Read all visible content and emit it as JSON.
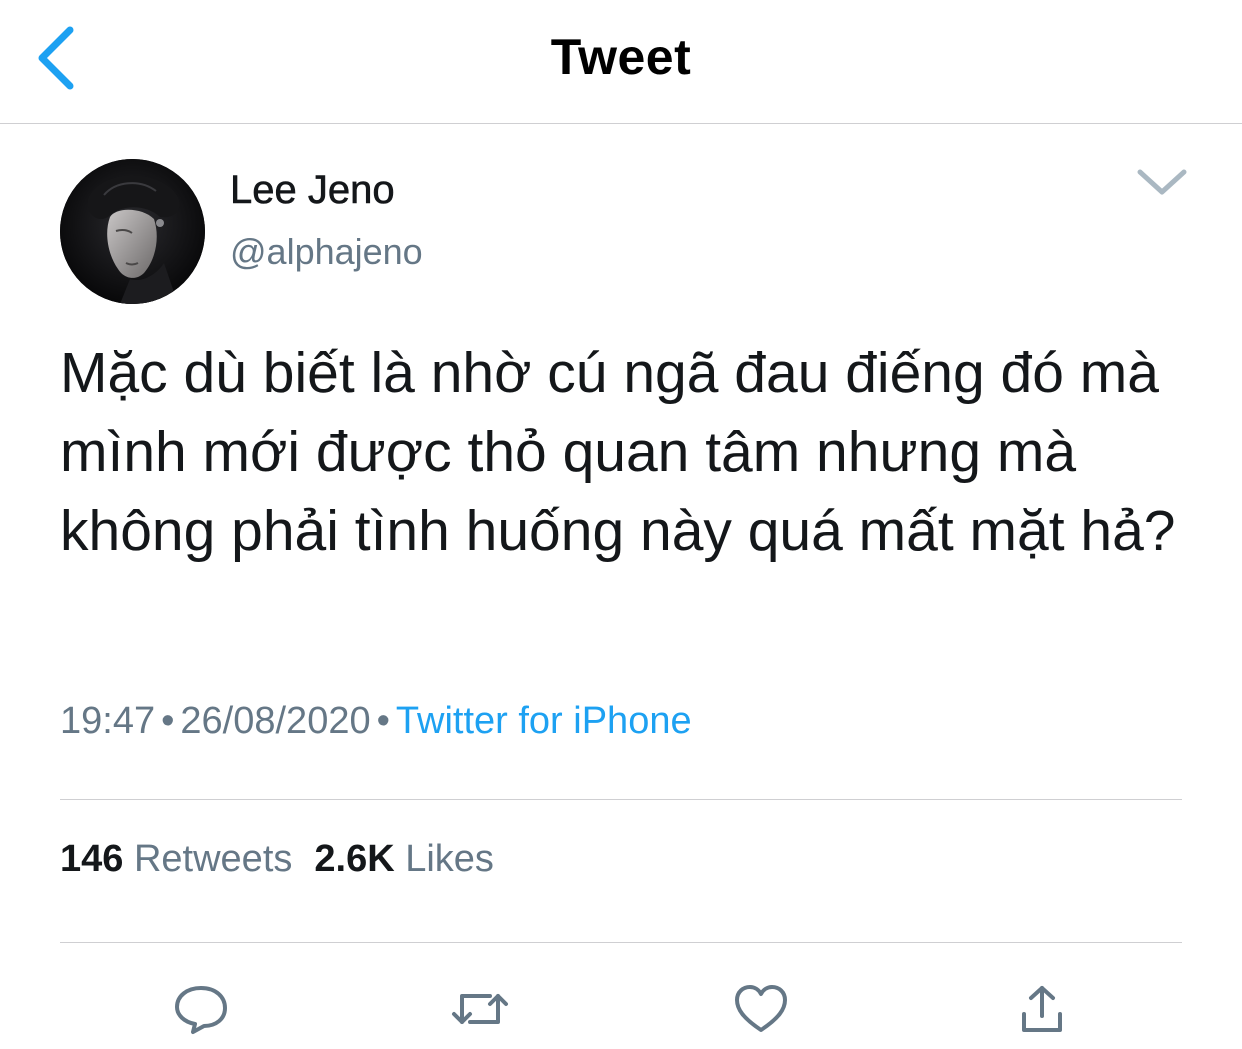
{
  "navbar": {
    "back_icon": "chevron-left-icon",
    "title": "Tweet"
  },
  "author": {
    "name": "Lee Jeno",
    "handle": "@alphajeno",
    "avatar": "profile-photo"
  },
  "tweet": {
    "text": "Mặc dù biết là nhờ cú ngã đau điếng đó mà mình mới được thỏ quan tâm nhưng mà không phải tình huống này quá mất mặt hả?",
    "time": "19:47",
    "date": "26/08/2020",
    "separator": "•",
    "source": "Twitter for iPhone"
  },
  "stats": {
    "retweets_count": "146",
    "retweets_label": "Retweets",
    "likes_count": "2.6K",
    "likes_label": "Likes"
  },
  "actions": [
    "reply-icon",
    "retweet-icon",
    "like-icon",
    "share-icon"
  ],
  "colors": {
    "accent": "#1da1f2",
    "icon_gray": "#657786",
    "text": "#14171a",
    "divider": "#cfcfd2"
  }
}
